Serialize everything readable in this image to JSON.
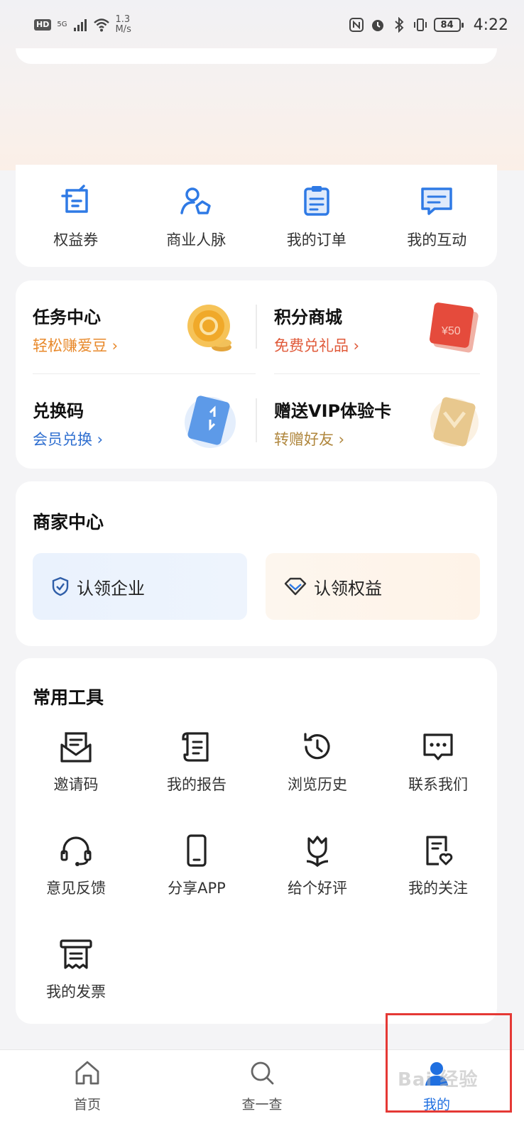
{
  "status_bar": {
    "hd": "HD",
    "network": "5G",
    "speed_value": "1.3",
    "speed_unit": "M/s",
    "battery": "84",
    "time": "4:22"
  },
  "quick_actions": [
    {
      "label": "权益券",
      "icon": "coupon-icon"
    },
    {
      "label": "商业人脉",
      "icon": "business-contacts-icon"
    },
    {
      "label": "我的订单",
      "icon": "orders-icon"
    },
    {
      "label": "我的互动",
      "icon": "interaction-icon"
    }
  ],
  "tasks": [
    {
      "title": "任务中心",
      "subtitle": "轻松赚爱豆 ›",
      "color": "#e8892b",
      "icon": "coin-icon"
    },
    {
      "title": "积分商城",
      "subtitle": "免费兑礼品 ›",
      "color": "#e05a3a",
      "icon": "gift-card-icon"
    },
    {
      "title": "兑换码",
      "subtitle": "会员兑换 ›",
      "color": "#2f6fd0",
      "icon": "exchange-card-icon"
    },
    {
      "title": "赠送VIP体验卡",
      "subtitle": "转赠好友 ›",
      "color": "#b0873e",
      "icon": "vip-card-icon"
    }
  ],
  "merchant": {
    "title": "商家中心",
    "claim_company": "认领企业",
    "claim_rights": "认领权益"
  },
  "tools": {
    "title": "常用工具",
    "items": [
      {
        "label": "邀请码",
        "icon": "invite-code-icon"
      },
      {
        "label": "我的报告",
        "icon": "report-icon"
      },
      {
        "label": "浏览历史",
        "icon": "history-icon"
      },
      {
        "label": "联系我们",
        "icon": "contact-icon"
      },
      {
        "label": "意见反馈",
        "icon": "feedback-icon"
      },
      {
        "label": "分享APP",
        "icon": "share-app-icon"
      },
      {
        "label": "给个好评",
        "icon": "rate-icon"
      },
      {
        "label": "我的关注",
        "icon": "follow-icon"
      },
      {
        "label": "我的发票",
        "icon": "invoice-icon"
      }
    ]
  },
  "bottom_nav": [
    {
      "label": "首页",
      "icon": "home-icon"
    },
    {
      "label": "查一查",
      "icon": "search-icon"
    },
    {
      "label": "我的",
      "icon": "profile-icon",
      "active": true
    }
  ],
  "watermark": "Bai 经验",
  "colors": {
    "accent_blue": "#1f6fe0",
    "highlight_red": "#e53935"
  }
}
